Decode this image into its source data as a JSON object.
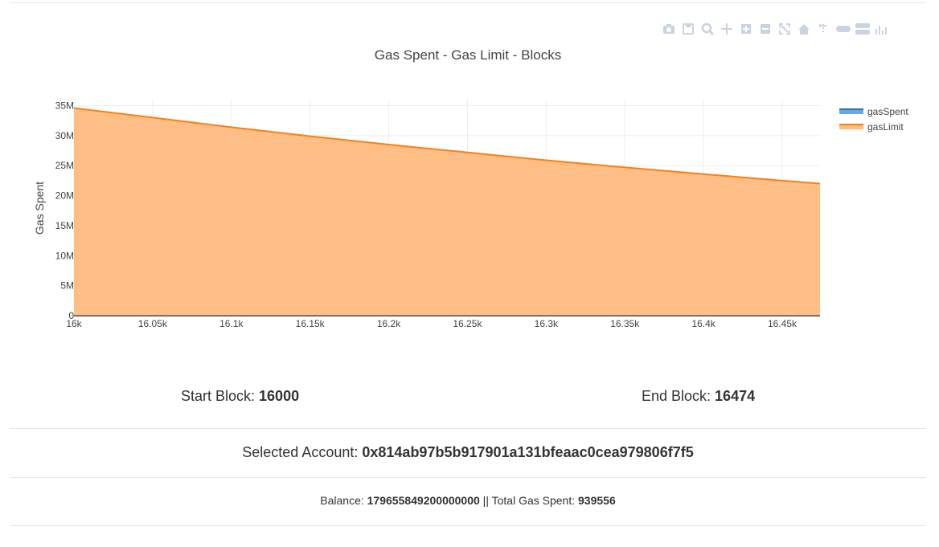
{
  "toolbar": {
    "icons": [
      "camera-icon",
      "save-icon",
      "zoom-icon",
      "pan-icon",
      "zoom-in-icon",
      "zoom-out-icon",
      "autoscale-icon",
      "home-icon",
      "spike-lines-icon",
      "hover-closest-icon",
      "hover-compare-icon",
      "plotly-logo-icon"
    ],
    "color": "#c9d3e3"
  },
  "chart_data": {
    "type": "area",
    "title": "Gas Spent - Gas Limit - Blocks",
    "xlabel": "",
    "ylabel": "Gas Spent",
    "xlim": [
      16000,
      16474
    ],
    "ylim": [
      0,
      36000000
    ],
    "x_ticks": [
      16000,
      16050,
      16100,
      16150,
      16200,
      16250,
      16300,
      16350,
      16400,
      16450
    ],
    "x_tick_labels": [
      "16k",
      "16.05k",
      "16.1k",
      "16.15k",
      "16.2k",
      "16.25k",
      "16.3k",
      "16.35k",
      "16.4k",
      "16.45k"
    ],
    "y_ticks": [
      0,
      5000000,
      10000000,
      15000000,
      20000000,
      25000000,
      30000000,
      35000000
    ],
    "y_tick_labels": [
      "0",
      "5M",
      "10M",
      "15M",
      "20M",
      "25M",
      "30M",
      "35M"
    ],
    "grid": true,
    "legend": "top-right",
    "series": [
      {
        "name": "gasSpent",
        "color": "#1f77b4",
        "fill": "#6fa8d6",
        "x": [
          16000,
          16100,
          16200,
          16300,
          16400,
          16474
        ],
        "y": [
          0,
          0,
          0,
          0,
          0,
          0
        ]
      },
      {
        "name": "gasLimit",
        "color": "#ff7f0e",
        "fill": "#ffbb80",
        "x": [
          16000,
          16050,
          16100,
          16150,
          16200,
          16250,
          16300,
          16350,
          16400,
          16450,
          16474
        ],
        "y": [
          34600000,
          33000000,
          31400000,
          29900000,
          28500000,
          27200000,
          25900000,
          24700000,
          23600000,
          22500000,
          22000000
        ]
      }
    ]
  },
  "info": {
    "start_label": "Start Block: ",
    "start_value": "16000",
    "end_label": "End Block: ",
    "end_value": "16474",
    "account_label": "Selected Account: ",
    "account_value": "0x814ab97b5b917901a131bfeaac0cea979806f7f5",
    "balance_label": "Balance: ",
    "balance_value": "179655849200000000",
    "separator": " || ",
    "gas_label": "Total Gas Spent: ",
    "gas_value": "939556"
  }
}
